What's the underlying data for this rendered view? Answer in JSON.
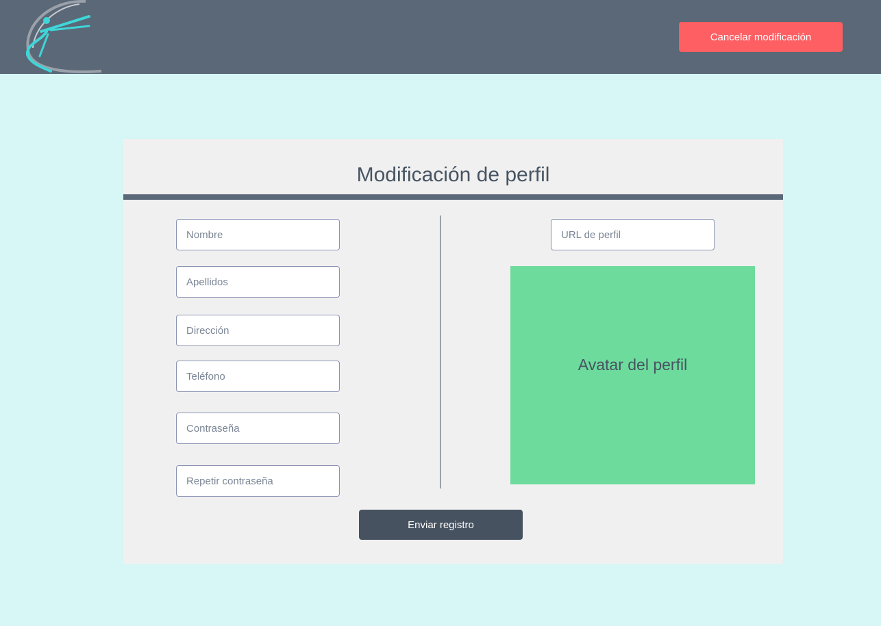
{
  "header": {
    "logo_icon": "dancer-logo-icon",
    "cancel_label": "Cancelar modificación"
  },
  "form": {
    "title": "Modificación de perfil",
    "fields": {
      "nombre": {
        "placeholder": "Nombre",
        "value": ""
      },
      "apellidos": {
        "placeholder": "Apellidos",
        "value": ""
      },
      "direccion": {
        "placeholder": "Dirección",
        "value": ""
      },
      "telefono": {
        "placeholder": "Teléfono",
        "value": ""
      },
      "contrasena": {
        "placeholder": "Contraseña",
        "value": ""
      },
      "repetir_contrasena": {
        "placeholder": "Repetir contraseña",
        "value": ""
      },
      "url_perfil": {
        "placeholder": "URL de perfil",
        "value": ""
      }
    },
    "avatar_label": "Avatar del perfil",
    "submit_label": "Enviar registro"
  },
  "colors": {
    "background": "#d7f6f6",
    "header": "#5a6878",
    "cancel_button": "#fd5f63",
    "avatar": "#6cdb9c",
    "submit_button": "#475260",
    "logo_accent": "#3fd6d8"
  }
}
